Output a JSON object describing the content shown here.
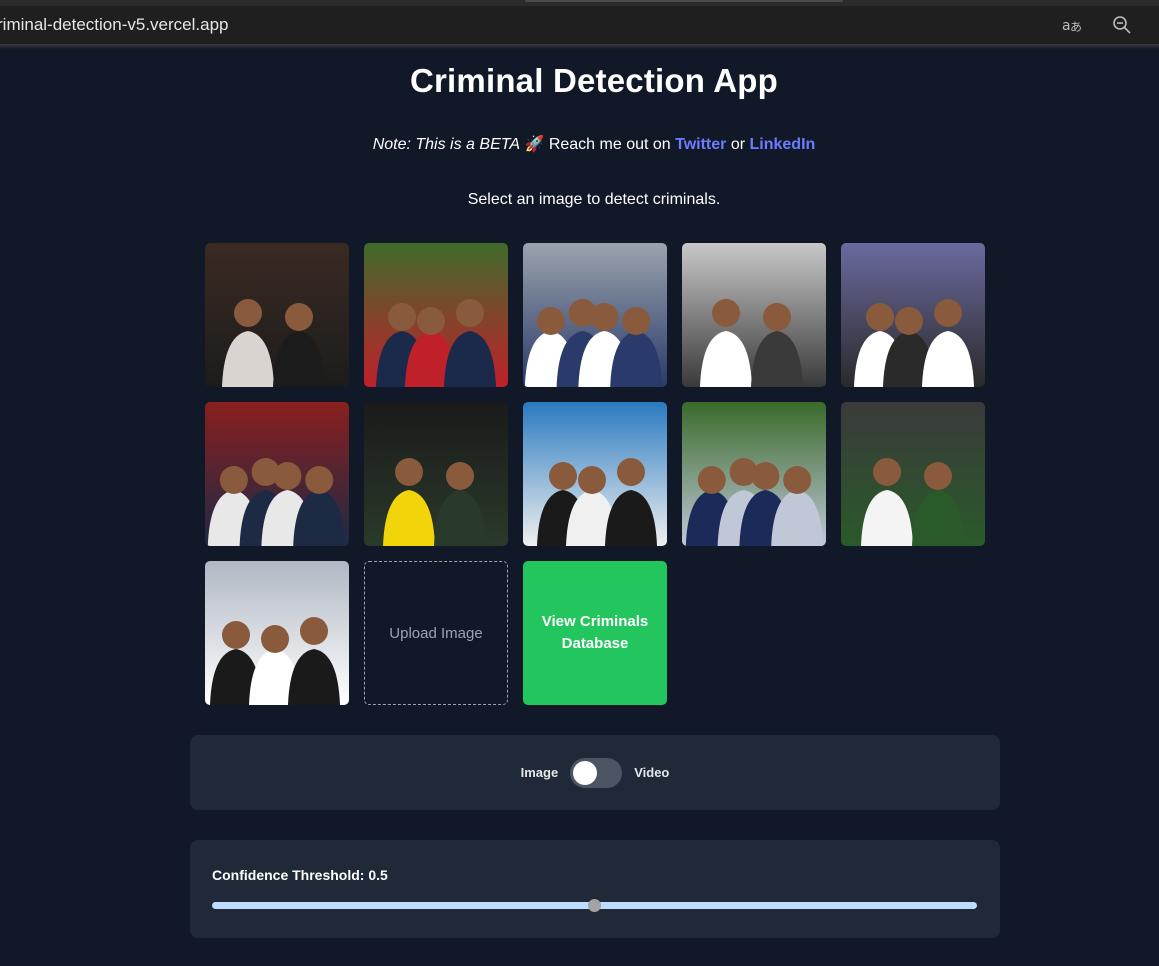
{
  "browser": {
    "url": "riminal-detection-v5.vercel.app",
    "icons": [
      "translate-icon",
      "zoom-out-icon"
    ]
  },
  "page": {
    "title": "Criminal Detection App",
    "note": {
      "prefix": "Note: This is a BETA",
      "emoji": "🚀",
      "middle": " Reach me out on ",
      "twitter": "Twitter",
      "or": " or ",
      "linkedin": "LinkedIn"
    },
    "instruction": "Select an image to detect criminals."
  },
  "gallery": {
    "images": [
      {
        "id": "sample-1",
        "palette": [
          "#3a2a22",
          "#d9d4cf",
          "#1c1c1c"
        ]
      },
      {
        "id": "sample-2",
        "palette": [
          "#3f6b2a",
          "#1b2a4a",
          "#c0202a"
        ]
      },
      {
        "id": "sample-3",
        "palette": [
          "#9aa3ad",
          "#ffffff",
          "#2a3a6a"
        ]
      },
      {
        "id": "sample-4",
        "palette": [
          "#c8c8c8",
          "#ffffff",
          "#3a3a3a"
        ]
      },
      {
        "id": "sample-5",
        "palette": [
          "#6a6aa0",
          "#ffffff",
          "#2a2a2a"
        ]
      },
      {
        "id": "sample-6",
        "palette": [
          "#8a1f1f",
          "#e8e8e8",
          "#1d2a44"
        ]
      },
      {
        "id": "sample-7",
        "palette": [
          "#1a1a1a",
          "#f2d40a",
          "#2a3a2a"
        ]
      },
      {
        "id": "sample-8",
        "palette": [
          "#2a7ac0",
          "#1a1a1a",
          "#f0f0f0"
        ]
      },
      {
        "id": "sample-9",
        "palette": [
          "#3a6a2a",
          "#1c2a5a",
          "#c0c8d8"
        ]
      },
      {
        "id": "sample-10",
        "palette": [
          "#3a3a3a",
          "#f4f4f4",
          "#2a5a2a"
        ]
      },
      {
        "id": "sample-11",
        "palette": [
          "#b0b8c4",
          "#1a1a1a",
          "#ffffff"
        ]
      }
    ],
    "upload_label": "Upload Image",
    "database_button": "View Criminals Database"
  },
  "mode_toggle": {
    "left_label": "Image",
    "right_label": "Video",
    "selected": "Image"
  },
  "confidence": {
    "label": "Confidence Threshold: 0.5",
    "value": 0.5,
    "min": 0,
    "max": 1
  },
  "colors": {
    "background": "#111827",
    "panel": "#1f2937",
    "accent_green": "#22c55e",
    "link": "#6c7cff",
    "slider_track": "#bfdbfe"
  }
}
